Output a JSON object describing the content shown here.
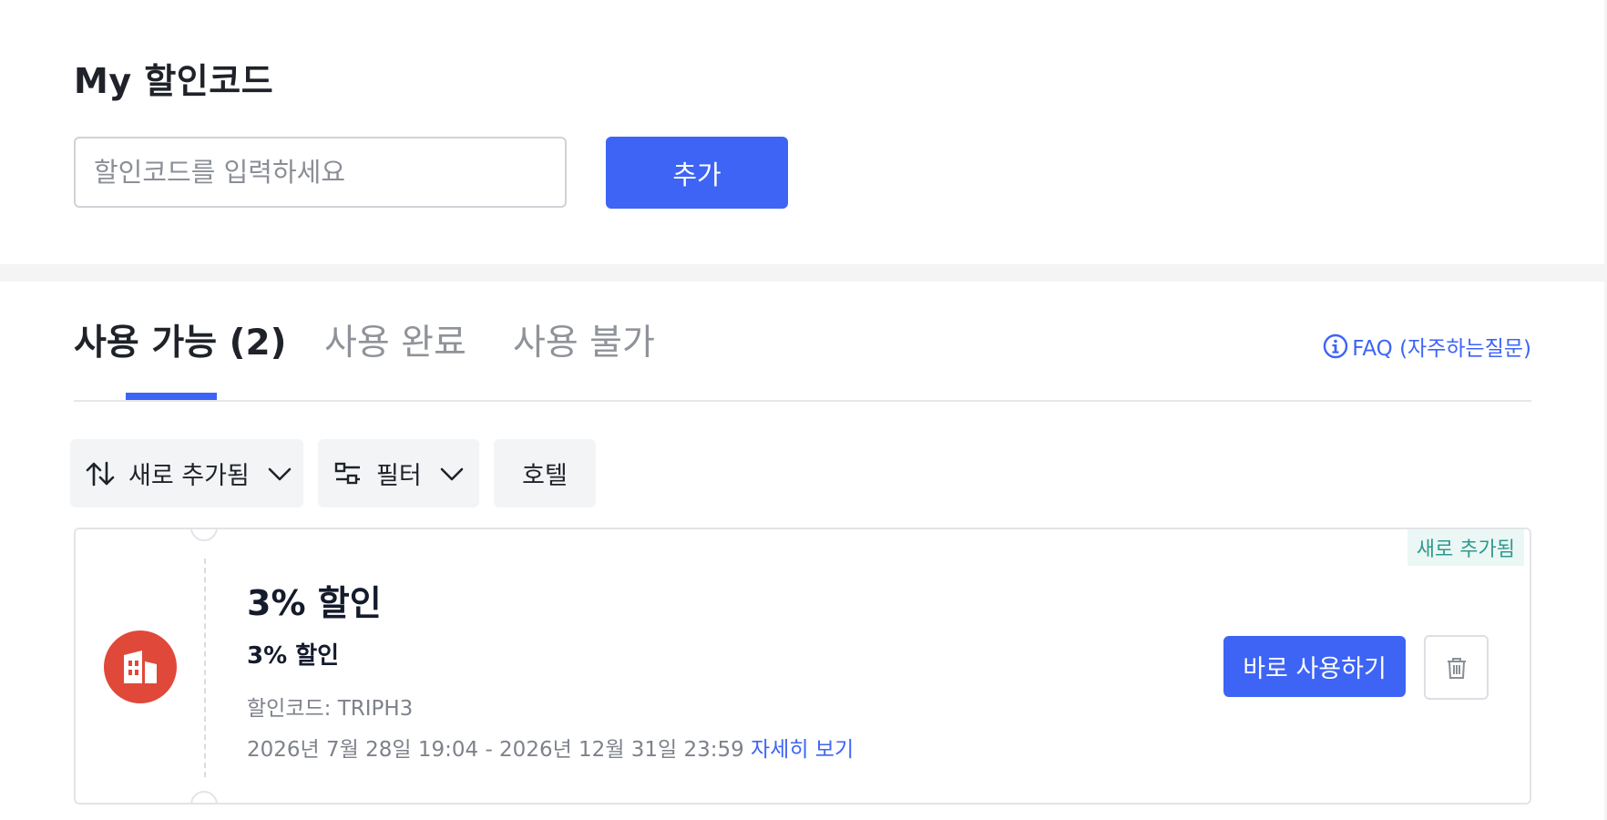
{
  "header": {
    "title": "My 할인코드"
  },
  "code_form": {
    "placeholder": "할인코드를 입력하세요",
    "value": "",
    "add_label": "추가"
  },
  "tabs": [
    {
      "label": "사용 가능 (2)",
      "active": true
    },
    {
      "label": "사용 완료",
      "active": false
    },
    {
      "label": "사용 불가",
      "active": false
    }
  ],
  "faq": {
    "label": "FAQ (자주하는질문)",
    "icon": "info-circle-icon"
  },
  "toolbar": {
    "sort_label": "새로 추가됨",
    "sort_icon": "sort-arrows-icon",
    "filter_label": "필터",
    "filter_icon": "filter-sliders-icon",
    "category_label": "호텔"
  },
  "coupons": [
    {
      "title": "3% 할인",
      "subtitle": "3% 할인",
      "code_line": "할인코드: TRIPH3",
      "validity": "2026년 7월 28일 19:04 - 2026년 12월 31일 23:59",
      "details_label": "자세히 보기",
      "badge": "새로 추가됨",
      "use_label": "바로 사용하기",
      "category_icon": "hotel-building-icon",
      "delete_icon": "trash-icon"
    }
  ],
  "colors": {
    "primary": "#3d64f5",
    "hotel_icon_bg": "#e0483a",
    "badge_bg": "#ebf7f5",
    "badge_text": "#2f9a8c"
  }
}
